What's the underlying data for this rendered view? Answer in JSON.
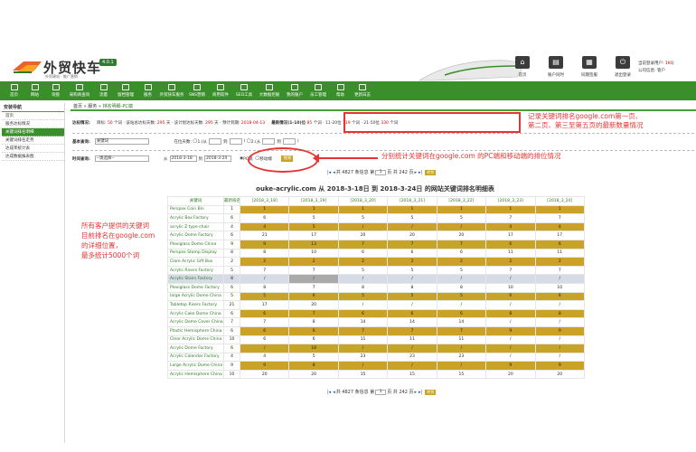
{
  "header": {
    "logo_text": "外贸快车",
    "logo_sub": "外贸建站 · 推广营销",
    "version": "4.0.1",
    "buttons": [
      {
        "label": "首页",
        "icon": "home-icon"
      },
      {
        "label": "账户同时",
        "icon": "account-icon"
      },
      {
        "label": "同期签服",
        "icon": "service-icon"
      },
      {
        "label": "退出登录",
        "icon": "power-icon"
      }
    ],
    "user_line1_label": "当前登录用户:",
    "user_line1_value": "1KQ",
    "user_line2_label": "公司信息:",
    "user_line2_value": "管户"
  },
  "nav": [
    {
      "label": "首页",
      "icon": "home-icon"
    },
    {
      "label": "网站",
      "icon": "site-icon"
    },
    {
      "label": "询盘",
      "icon": "inquiry-icon"
    },
    {
      "label": "采购商查询",
      "icon": "buyer-search-icon"
    },
    {
      "label": "流量",
      "icon": "traffic-icon"
    },
    {
      "label": "留档管理",
      "icon": "archive-icon"
    },
    {
      "label": "服务",
      "icon": "service-icon"
    },
    {
      "label": "外贸快车服务",
      "icon": "express-icon"
    },
    {
      "label": "SNS营销",
      "icon": "sns-icon"
    },
    {
      "label": "商用软件",
      "icon": "software-icon"
    },
    {
      "label": "SEO工具",
      "icon": "seo-icon"
    },
    {
      "label": "大数据挖掘",
      "icon": "data-icon"
    },
    {
      "label": "我的账户",
      "icon": "user-icon"
    },
    {
      "label": "员工管理",
      "icon": "staff-icon"
    },
    {
      "label": "帮助",
      "icon": "help-icon"
    },
    {
      "label": "更新日志",
      "icon": "log-icon"
    }
  ],
  "sidebar": {
    "title": "安装导航",
    "items": [
      {
        "label": "首页"
      },
      {
        "label": "服务达标情况"
      },
      {
        "label": "关键词排名明细"
      },
      {
        "label": "关键词排名走势"
      },
      {
        "label": "达成率统计表"
      },
      {
        "label": "达成数据报表图"
      }
    ]
  },
  "breadcrumb": {
    "home": "首页",
    "service": "服务",
    "current": "排名明细-PC端",
    "sep": " » "
  },
  "stats": {
    "label": "达标情况:",
    "target_label": "目标:",
    "target_value": "50",
    "target_unit": "个词 · 该站总达标天数:",
    "days_value": "295",
    "days_unit": "天 · 该计划达标天数:",
    "plan_days_value": "295",
    "plan_days_unit": "天 · 预计到期:",
    "expire_value": "2018-04-13",
    "latest_label": "最新情况(1-10)位",
    "latest_value": "85",
    "p2_label": "个词 · 11-20位",
    "p2_value": "119",
    "p3_label": "个词 · 21-50位",
    "p3_value": "330",
    "tail": "个词"
  },
  "basic_query": {
    "label": "基本查询:",
    "keyword_label": "关键词",
    "pos_label": "在位天数:",
    "radio1_pre": "1.(从",
    "radio1_mid": "到",
    "radio1_post": ")",
    "radio2_pre": "2.(从",
    "radio2_mid": "到",
    "radio2_post": ")"
  },
  "time_query": {
    "label": "时间查询:",
    "select_value": "--请选择--",
    "from_label": "从",
    "from_date": "2018-3-18",
    "to_label": "到",
    "to_date": "2018-3-24",
    "pc_label": "PC端",
    "mobile_label": "移动端",
    "search_label": "搜索"
  },
  "pager": {
    "text_pre": "共 4827 条信息 第",
    "page": "1",
    "text_post": "页 共 242 页",
    "go": "转到"
  },
  "table": {
    "title": "ouke-acrylic.com 从 2018-3-18日 到 2018-3-24日 的网站关键词排名明细表",
    "col_keyword": "关键词",
    "col_best": "最新排名",
    "dates": [
      "[2018_3_18]",
      "[2018_3_19]",
      "[2018_3_20]",
      "[2018_3_21]",
      "[2018_3_22]",
      "[2018_3_23]",
      "[2018_3_24]"
    ],
    "rows": [
      {
        "kw": "Perspex Coin Bin",
        "best": "1",
        "v": [
          "1",
          "1",
          "1",
          "1",
          "1",
          "1",
          "1"
        ]
      },
      {
        "kw": "Acrylic Box Factory",
        "best": "6",
        "v": [
          "6",
          "5",
          "5",
          "5",
          "5",
          "7",
          "7"
        ]
      },
      {
        "kw": "acrylic Z type chair",
        "best": "4",
        "v": [
          "4",
          "5",
          "/",
          "/",
          "/",
          "4",
          "4"
        ]
      },
      {
        "kw": "Acrylic Dome Factory",
        "best": "6",
        "v": [
          "21",
          "17",
          "20",
          "20",
          "20",
          "17",
          "17"
        ]
      },
      {
        "kw": "Plexiglass Dome China",
        "best": "9",
        "v": [
          "9",
          "13",
          "7",
          "7",
          "7",
          "6",
          "6"
        ]
      },
      {
        "kw": "Perspex Stamp Display",
        "best": "8",
        "v": [
          "8",
          "10",
          "6",
          "6",
          "6",
          "11",
          "11"
        ]
      },
      {
        "kw": "Clare Acrylic Gift Box",
        "best": "2",
        "v": [
          "2",
          "2",
          "2",
          "2",
          "2",
          "2",
          "2"
        ]
      },
      {
        "kw": "Acrylic Risers Factory",
        "best": "5",
        "v": [
          "7",
          "7",
          "5",
          "5",
          "5",
          "7",
          "7"
        ]
      },
      {
        "kw": "Acrylic Stairs Factory",
        "best": "8",
        "v": [
          "/",
          "/",
          "/",
          "/",
          "/",
          "/",
          "/"
        ]
      },
      {
        "kw": "Plexiglass Dome Factory",
        "best": "6",
        "v": [
          "8",
          "7",
          "8",
          "8",
          "8",
          "10",
          "10"
        ]
      },
      {
        "kw": "large Acrylic Dome China",
        "best": "5",
        "v": [
          "5",
          "6",
          "5",
          "5",
          "5",
          "6",
          "6"
        ]
      },
      {
        "kw": "Tabletop Risers Factory",
        "best": "21",
        "v": [
          "17",
          "20",
          "/",
          "/",
          "/",
          "/",
          "/"
        ]
      },
      {
        "kw": "Acrylic Cake Dome China",
        "best": "6",
        "v": [
          "6",
          "7",
          "6",
          "6",
          "6",
          "8",
          "8"
        ]
      },
      {
        "kw": "Acrylic Dome Cover China",
        "best": "7",
        "v": [
          "7",
          "8",
          "14",
          "14",
          "14",
          "/",
          "/"
        ]
      },
      {
        "kw": "Plastic Hemisphere China",
        "best": "6",
        "v": [
          "6",
          "6",
          "7",
          "7",
          "7",
          "9",
          "9"
        ]
      },
      {
        "kw": "Clear Acrylic Dome China",
        "best": "10",
        "v": [
          "6",
          "6",
          "11",
          "11",
          "11",
          "/",
          "/"
        ]
      },
      {
        "kw": "Acrylic Dome Factory",
        "best": "6",
        "v": [
          "/",
          "18",
          "/",
          "/",
          "/",
          "/",
          "/"
        ]
      },
      {
        "kw": "Acrylic Calendar Factory",
        "best": "4",
        "v": [
          "4",
          "5",
          "23",
          "23",
          "23",
          "/",
          "/"
        ]
      },
      {
        "kw": "Large Acrylic Dome China",
        "best": "9",
        "v": [
          "9",
          "8",
          "/",
          "/",
          "/",
          "9",
          "9"
        ]
      },
      {
        "kw": "Acrylic Hemisphere China",
        "best": "10",
        "v": [
          "20",
          "20",
          "15",
          "15",
          "15",
          "20",
          "20"
        ]
      }
    ]
  },
  "annotations": {
    "note1_line1": "记录关键词排名google.com第一页、",
    "note1_line2": "第二页、第三至第五页的最新数量情况",
    "note2": "分别统计关键词在google.com 的PC端和移动端的排位情况",
    "note3_line1": "所有客户提供的关键词",
    "note3_line2": "目前排名在google.com",
    "note3_line3": "的详细位置，",
    "note3_line4": "最多统计5000个词"
  },
  "colors": {
    "brand_green": "#3a8f2b",
    "gold_cell": "#c9a227",
    "annotation_red": "#e83333"
  }
}
